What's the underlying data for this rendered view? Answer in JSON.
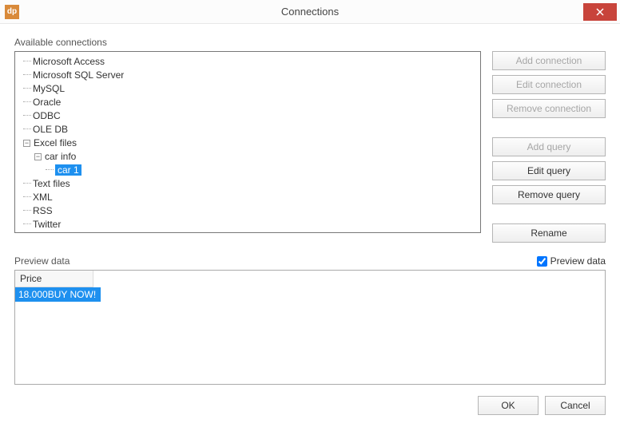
{
  "window": {
    "title": "Connections",
    "app_icon_text": "dp"
  },
  "labels": {
    "available": "Available connections",
    "preview": "Preview data"
  },
  "tree": {
    "items": [
      "Microsoft Access",
      "Microsoft SQL Server",
      "MySQL",
      "Oracle",
      "ODBC",
      "OLE DB"
    ],
    "excel": {
      "label": "Excel files",
      "child_label": "car info",
      "leaf_label": "car 1"
    },
    "after": [
      "Text files",
      "XML",
      "RSS",
      "Twitter"
    ]
  },
  "buttons": {
    "add_conn": "Add connection",
    "edit_conn": "Edit connection",
    "remove_conn": "Remove connection",
    "add_query": "Add query",
    "edit_query": "Edit query",
    "remove_query": "Remove query",
    "rename": "Rename",
    "ok": "OK",
    "cancel": "Cancel"
  },
  "preview": {
    "checkbox_label": "Preview data",
    "col_header": "Price",
    "row0": "18.000BUY NOW!"
  }
}
